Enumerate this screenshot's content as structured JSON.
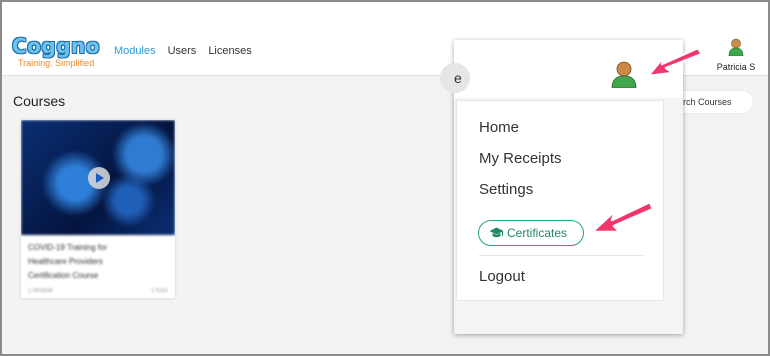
{
  "brand": {
    "name": "Coggno",
    "tagline": "Training. Simplified"
  },
  "nav": [
    {
      "label": "Modules",
      "active": true
    },
    {
      "label": "Users",
      "active": false
    },
    {
      "label": "Licenses",
      "active": false
    }
  ],
  "user": {
    "name": "Patricia S"
  },
  "page": {
    "title": "Courses"
  },
  "search": {
    "visible_text": "earch Courses"
  },
  "course_card": {
    "title_lines": [
      "COVID-19 Training for",
      "Healthcare Providers",
      "Certification Course"
    ],
    "footer_left": "1 Module",
    "footer_right": "1 hour"
  },
  "dropdown": {
    "partial_glyph": "e",
    "items": [
      "Home",
      "My Receipts",
      "Settings"
    ],
    "certificates_label": "Certificates",
    "logout_label": "Logout"
  },
  "colors": {
    "accent": "#2b9bd8",
    "certificates": "#27a37a",
    "arrow": "#f2366b"
  }
}
